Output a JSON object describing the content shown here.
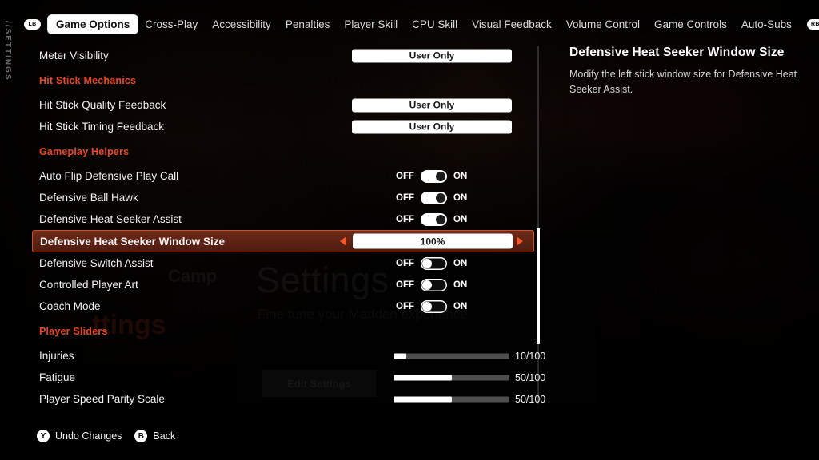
{
  "side_tag": "//SETTINGS",
  "tabbar": {
    "left_bumper": "LB",
    "right_bumper": "RB",
    "tabs": [
      {
        "label": "Game Options",
        "active": true
      },
      {
        "label": "Cross-Play",
        "active": false
      },
      {
        "label": "Accessibility",
        "active": false
      },
      {
        "label": "Penalties",
        "active": false
      },
      {
        "label": "Player Skill",
        "active": false
      },
      {
        "label": "CPU Skill",
        "active": false
      },
      {
        "label": "Visual Feedback",
        "active": false
      },
      {
        "label": "Volume Control",
        "active": false
      },
      {
        "label": "Game Controls",
        "active": false
      },
      {
        "label": "Auto-Subs",
        "active": false
      }
    ]
  },
  "background": {
    "ghost_title": "Settings",
    "ghost_subtitle": "Fine tune your Madden experience",
    "ghost_button": "Edit Settings",
    "ghost_red": "ttings",
    "ghost_red2": "Camp"
  },
  "list": {
    "rows": [
      {
        "type": "dropdown",
        "label": "Meter Visibility",
        "value": "User Only"
      },
      {
        "type": "section",
        "label": "Hit Stick Mechanics"
      },
      {
        "type": "dropdown",
        "label": "Hit Stick Quality Feedback",
        "value": "User Only"
      },
      {
        "type": "dropdown",
        "label": "Hit Stick Timing Feedback",
        "value": "User Only"
      },
      {
        "type": "section",
        "label": "Gameplay Helpers"
      },
      {
        "type": "toggle",
        "label": "Auto Flip Defensive Play Call",
        "off_label": "OFF",
        "on_label": "ON",
        "state": "on"
      },
      {
        "type": "toggle",
        "label": "Defensive Ball Hawk",
        "off_label": "OFF",
        "on_label": "ON",
        "state": "on"
      },
      {
        "type": "toggle",
        "label": "Defensive Heat Seeker Assist",
        "off_label": "OFF",
        "on_label": "ON",
        "state": "on"
      },
      {
        "type": "stepper",
        "label": "Defensive Heat Seeker Window Size",
        "value": "100%",
        "selected": true
      },
      {
        "type": "toggle",
        "label": "Defensive Switch Assist",
        "off_label": "OFF",
        "on_label": "ON",
        "state": "off"
      },
      {
        "type": "toggle",
        "label": "Controlled Player Art",
        "off_label": "OFF",
        "on_label": "ON",
        "state": "off"
      },
      {
        "type": "toggle",
        "label": "Coach Mode",
        "off_label": "OFF",
        "on_label": "ON",
        "state": "off"
      },
      {
        "type": "section",
        "label": "Player Sliders"
      },
      {
        "type": "slider",
        "label": "Injuries",
        "value": "10/100",
        "percent": 10
      },
      {
        "type": "slider",
        "label": "Fatigue",
        "value": "50/100",
        "percent": 50
      },
      {
        "type": "slider",
        "label": "Player Speed Parity Scale",
        "value": "50/100",
        "percent": 50
      }
    ]
  },
  "info": {
    "title": "Defensive Heat Seeker Window Size",
    "description": "Modify the left stick window size for Defensive Heat Seeker Assist."
  },
  "prompts": [
    {
      "glyph": "Y",
      "label": "Undo Changes"
    },
    {
      "glyph": "B",
      "label": "Back"
    }
  ],
  "colors": {
    "accent_red": "#e8471f",
    "selected_border": "#c8512c",
    "arrow": "#f2572b",
    "white": "#ffffff"
  }
}
